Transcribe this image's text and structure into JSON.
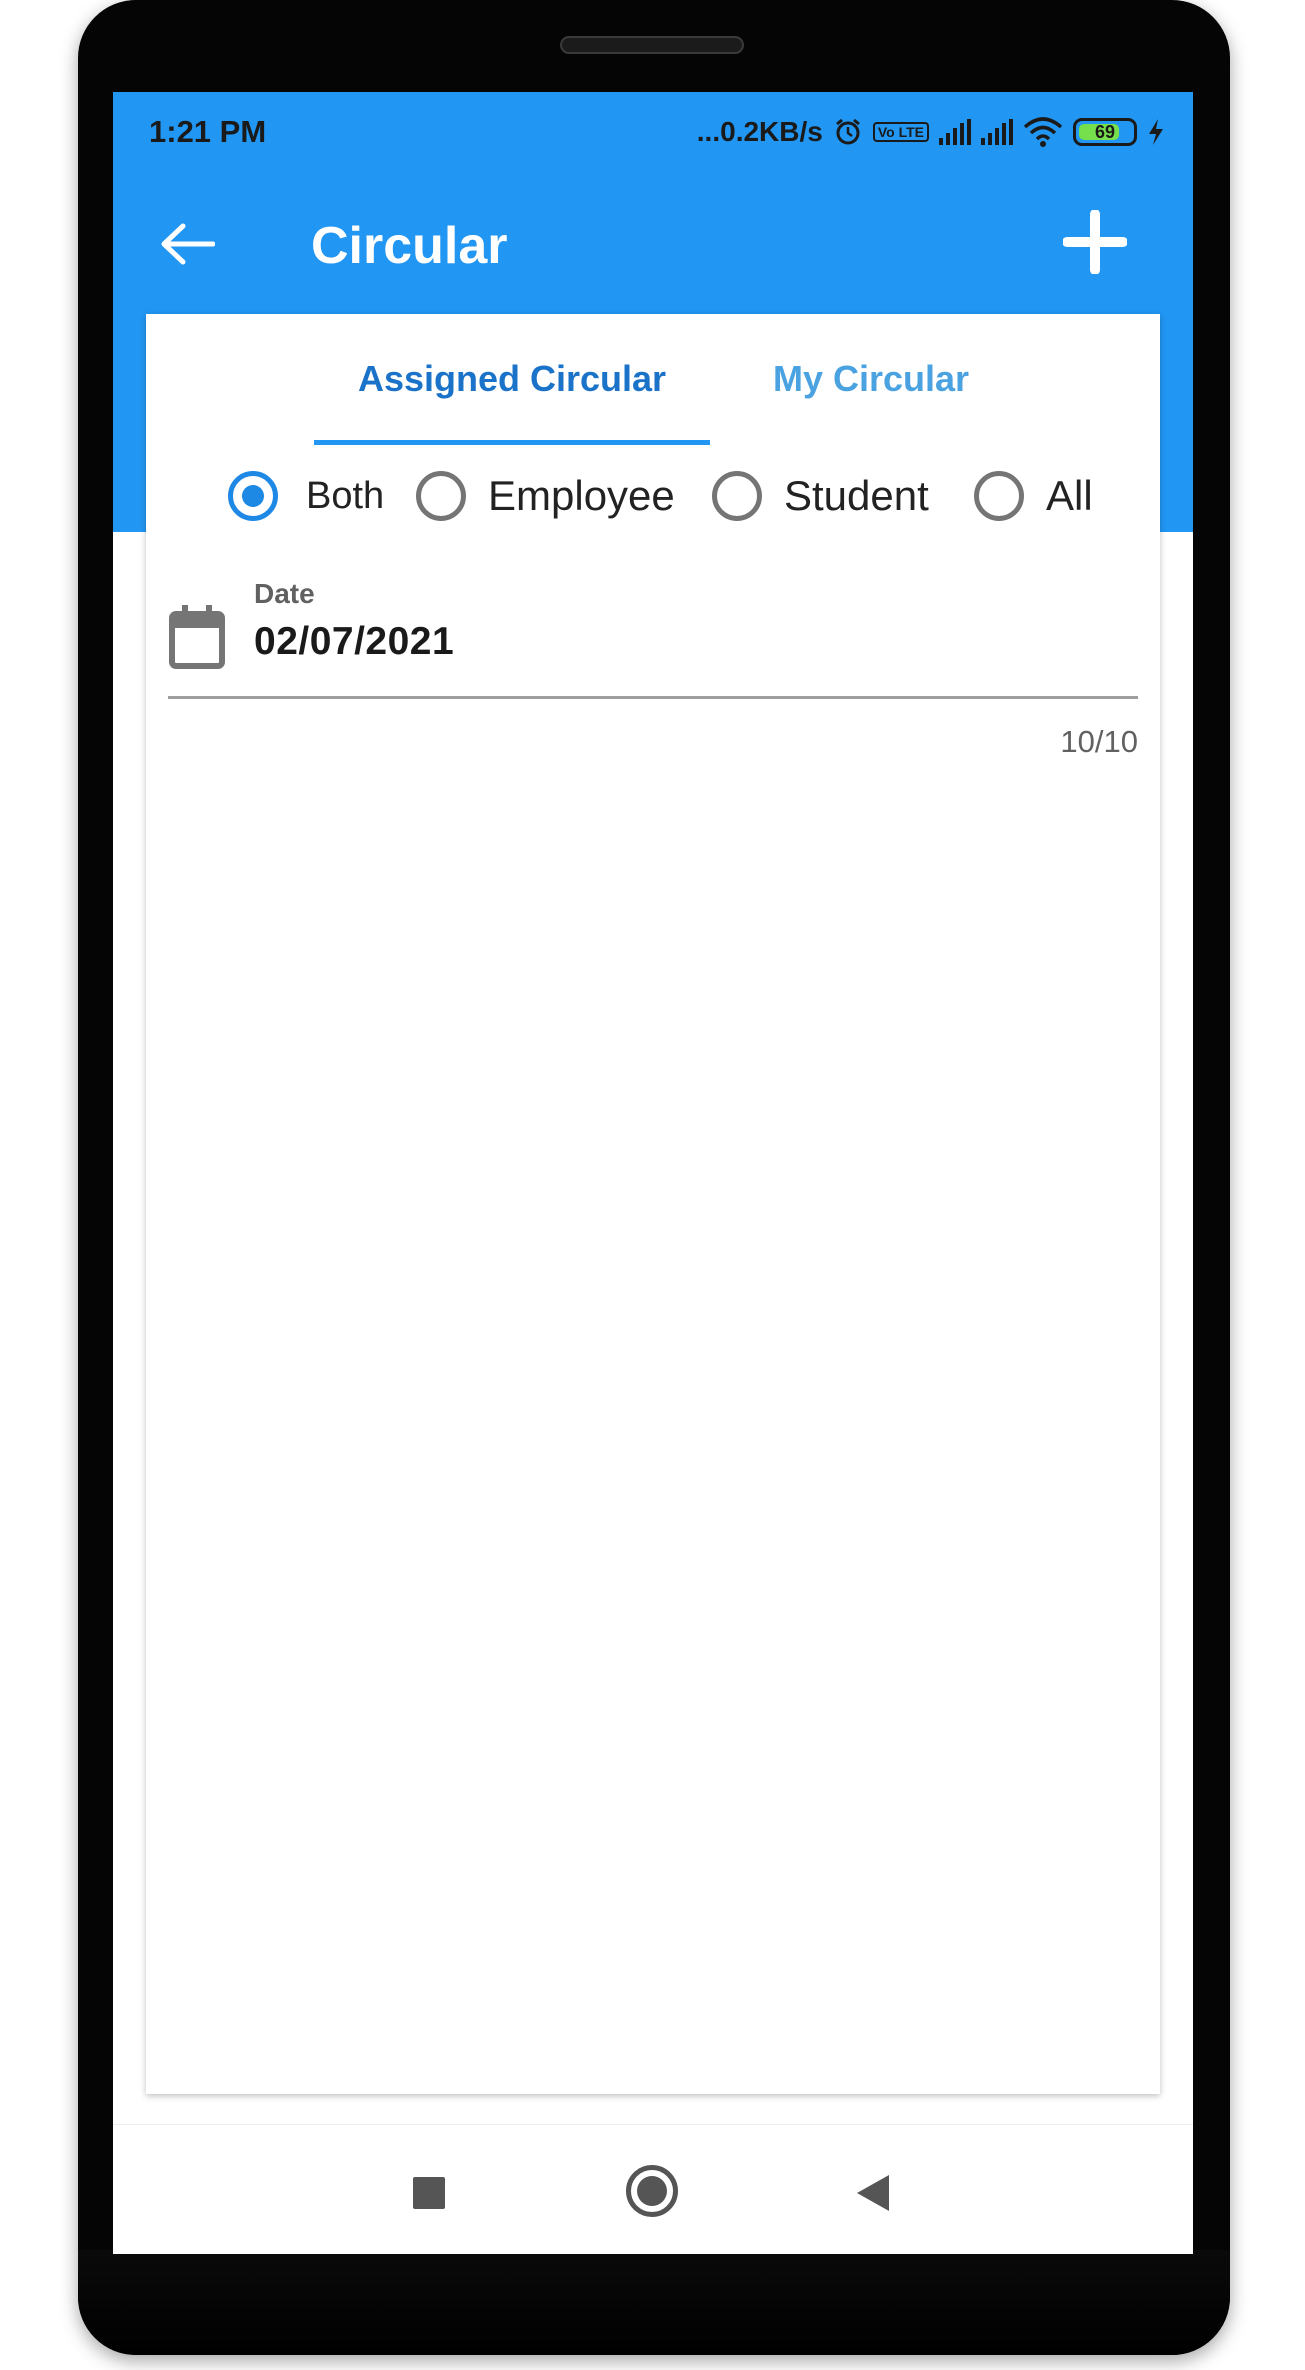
{
  "status_bar": {
    "time": "1:21 PM",
    "network_speed": "...0.2KB/s",
    "volte": "Vo LTE",
    "battery": "69",
    "icons": [
      "alarm-icon",
      "signal-icon",
      "wifi-icon",
      "battery-icon",
      "charging-icon"
    ]
  },
  "app_bar": {
    "title": "Circular",
    "back_icon": "arrow-left-icon",
    "add_icon": "plus-icon",
    "color": "#2196f3"
  },
  "tabs": {
    "items": [
      {
        "label": "Assigned Circular",
        "selected": true
      },
      {
        "label": "My Circular",
        "selected": false
      }
    ]
  },
  "filter": {
    "options": [
      {
        "label": "Both",
        "checked": true
      },
      {
        "label": "Employee",
        "checked": false
      },
      {
        "label": "Student",
        "checked": false
      },
      {
        "label": "All",
        "checked": false
      }
    ]
  },
  "date_field": {
    "label": "Date",
    "value": "02/07/2021",
    "icon": "calendar-icon"
  },
  "counter": "10/10",
  "nav_bar": {
    "icons": [
      "recents-icon",
      "home-icon",
      "back-icon"
    ]
  }
}
